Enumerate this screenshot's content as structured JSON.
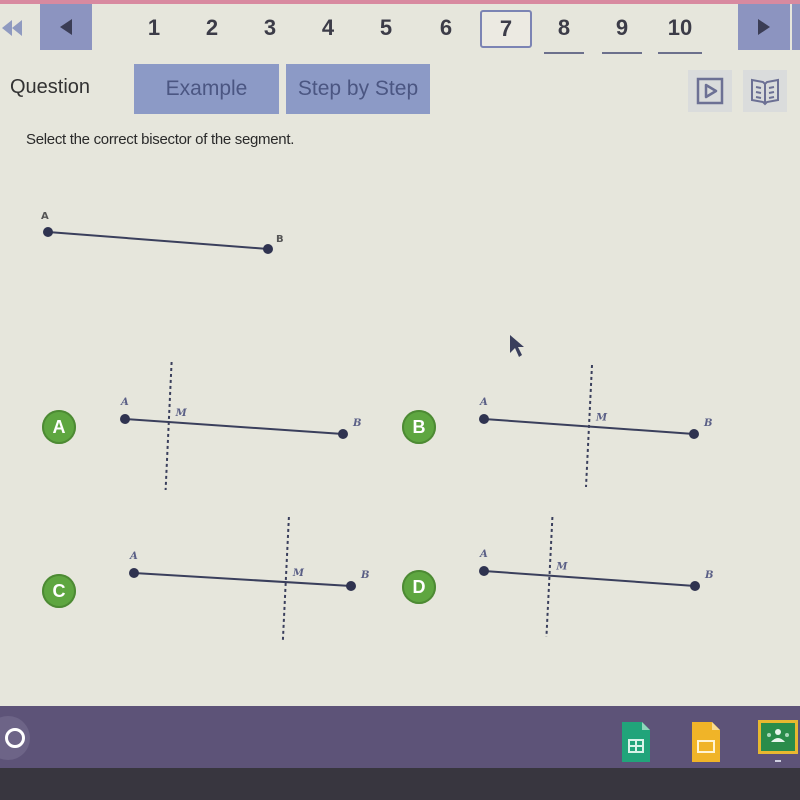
{
  "pager": {
    "first_icon": "skip-to-first-icon",
    "prev_icon": "previous-arrow-icon",
    "next_icon": "next-arrow-icon",
    "pages": [
      "1",
      "2",
      "3",
      "4",
      "5",
      "6",
      "7",
      "8",
      "9",
      "10"
    ],
    "current_page": "7",
    "underlined_pages": [
      "8",
      "9",
      "10"
    ]
  },
  "tabs": {
    "question": "Question",
    "example": "Example",
    "step_by_step": "Step by Step"
  },
  "tools": {
    "video_icon": "play-video-icon",
    "book_icon": "reference-book-icon"
  },
  "question": {
    "prompt": "Select the correct bisector of the segment.",
    "segment": {
      "label_a": "A",
      "label_b": "B"
    }
  },
  "options": [
    {
      "letter": "A",
      "label_a": "A",
      "label_m": "M",
      "label_b": "B",
      "bisector_position": 0.2
    },
    {
      "letter": "B",
      "label_a": "A",
      "label_m": "M",
      "label_b": "B",
      "bisector_position": 0.5
    },
    {
      "letter": "C",
      "label_a": "A",
      "label_m": "M",
      "label_b": "B",
      "bisector_position": 0.7
    },
    {
      "letter": "D",
      "label_a": "A",
      "label_m": "M",
      "label_b": "B",
      "bisector_position": 0.31
    }
  ],
  "taskbar": {
    "launcher_icon": "launcher-circle-icon",
    "apps": [
      {
        "name": "Google Sheets",
        "icon": "sheets-icon",
        "color": "#21a47a"
      },
      {
        "name": "Google Slides",
        "icon": "slides-icon",
        "color": "#f0b428"
      },
      {
        "name": "Google Classroom",
        "icon": "classroom-icon",
        "color": "#2a8c4a"
      }
    ]
  },
  "colors": {
    "accent_nav": "#8c94c0",
    "badge_green": "#5ea640",
    "segment": "#3a3f5c",
    "taskbar": "#5d5378"
  }
}
